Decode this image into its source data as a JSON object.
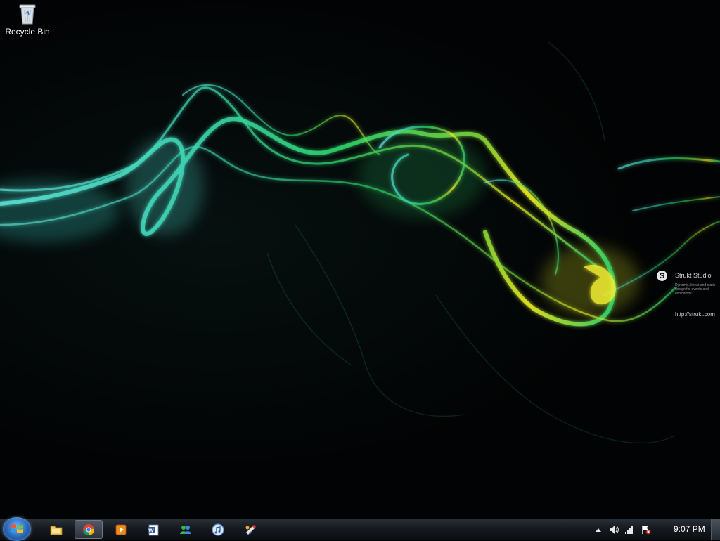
{
  "desktop": {
    "icons": [
      {
        "label": "Recycle Bin",
        "icon": "recycle-bin-icon"
      }
    ],
    "wallpaper": {
      "brand_name": "Strukt Studio",
      "brand_tagline": "Dynamic, linear and static design for events and exhibitions",
      "brand_url": "http://strukt.com",
      "logo_letter": "S"
    }
  },
  "taskbar": {
    "start_icon": "windows-logo-icon",
    "pinned": [
      {
        "name": "Windows Explorer",
        "icon": "folder-icon",
        "active": false
      },
      {
        "name": "Google Chrome",
        "icon": "chrome-icon",
        "active": true
      },
      {
        "name": "Windows Media Player",
        "icon": "media-player-icon",
        "active": false
      },
      {
        "name": "Microsoft Word",
        "icon": "word-icon",
        "active": false
      },
      {
        "name": "Windows Live Messenger",
        "icon": "messenger-icon",
        "active": false
      },
      {
        "name": "iTunes",
        "icon": "itunes-icon",
        "active": false
      },
      {
        "name": "Paint",
        "icon": "paint-icon",
        "active": false
      }
    ],
    "tray": {
      "icons": [
        "show-hidden-icons-icon",
        "volume-icon",
        "network-signal-icon",
        "action-center-flag-icon"
      ],
      "clock": "9:07 PM"
    }
  },
  "colors": {
    "cyan": "#4fe0d0",
    "green": "#33e07a",
    "yellow": "#e8e81e"
  }
}
